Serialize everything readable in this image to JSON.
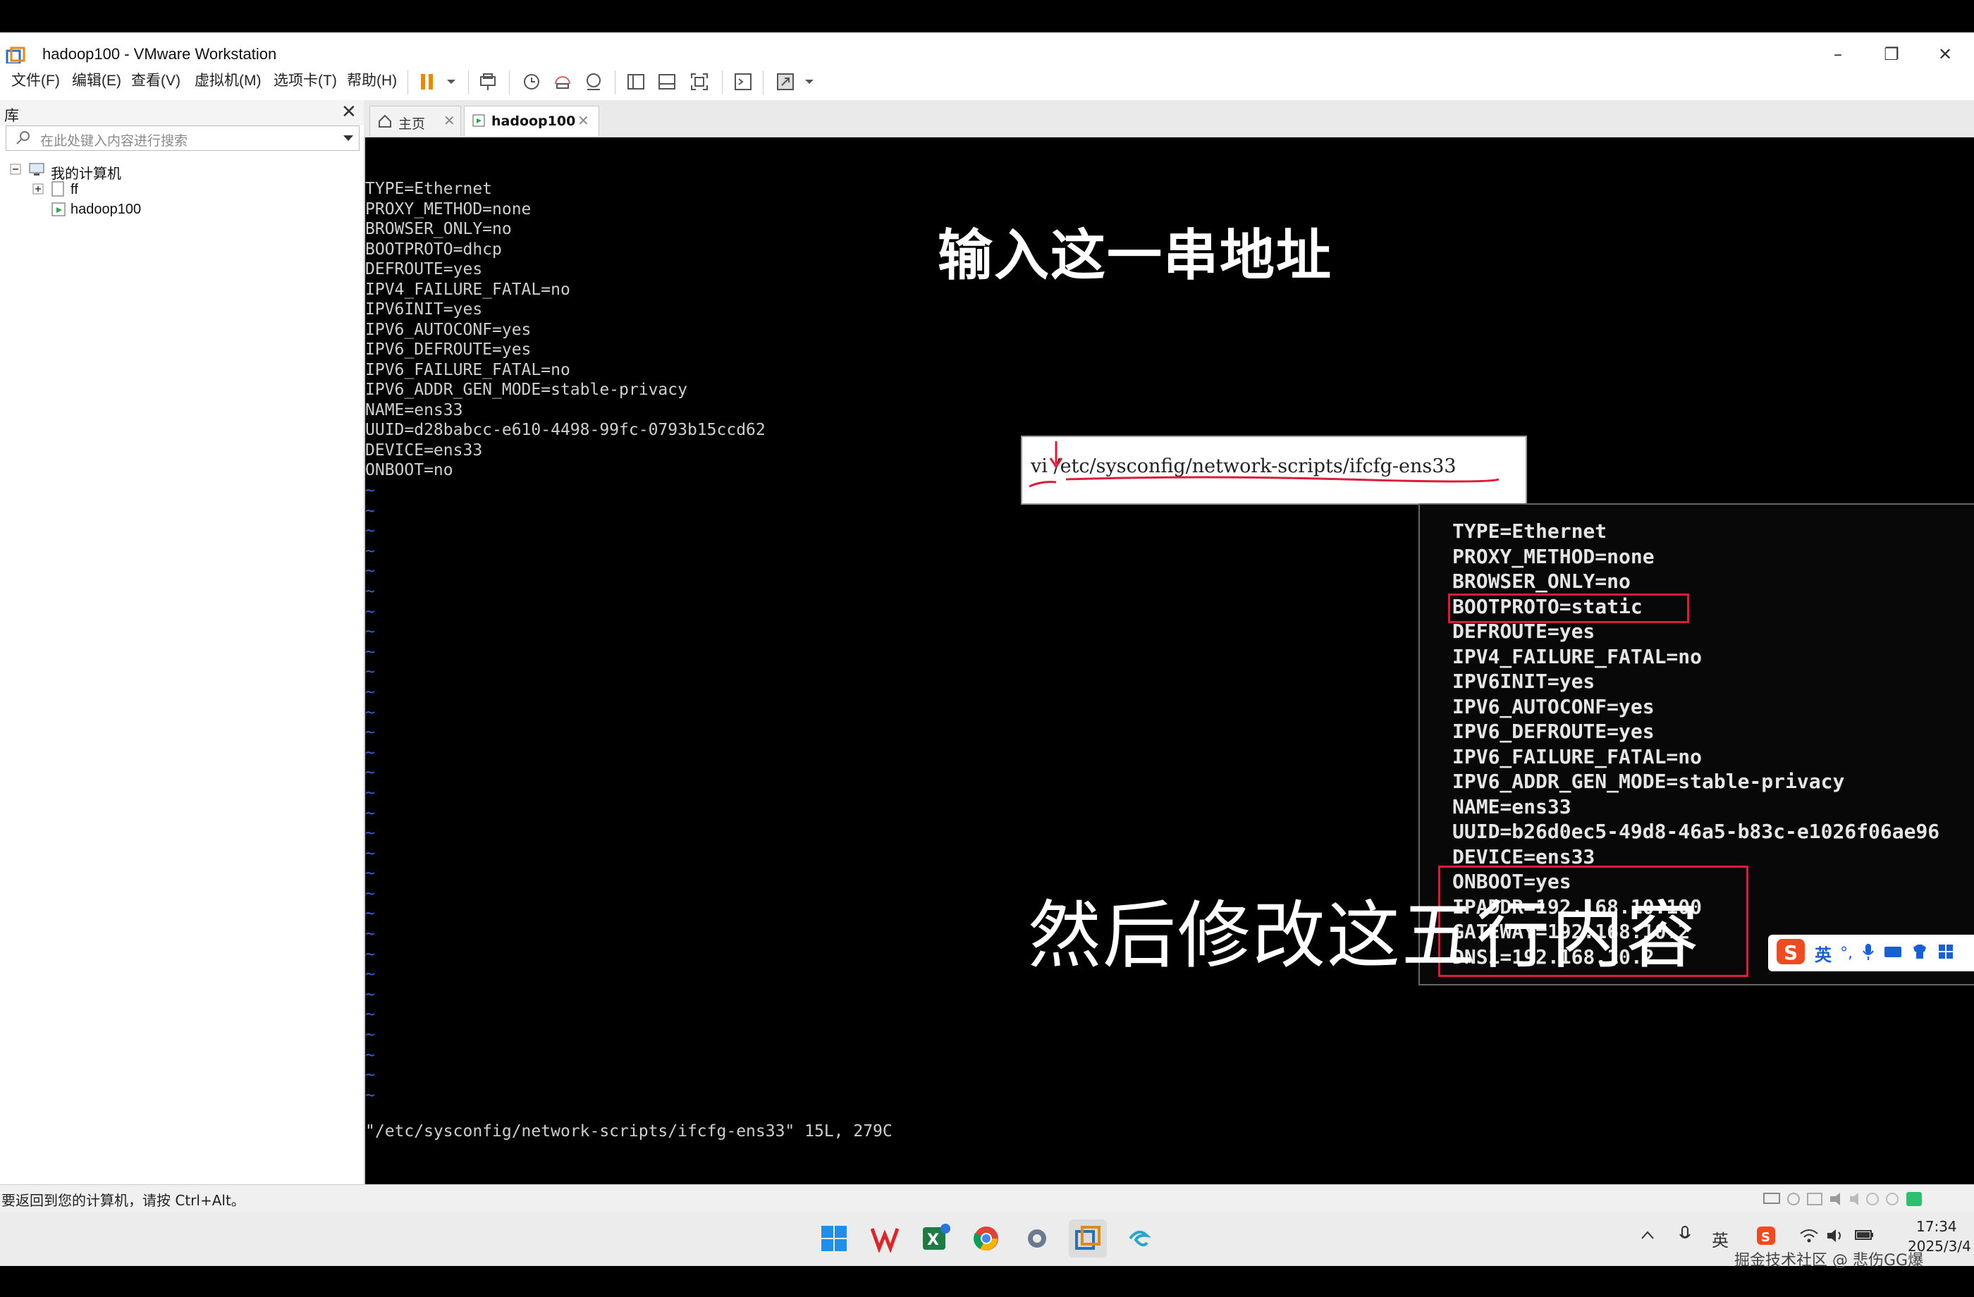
{
  "window": {
    "title": "hadoop100 - VMware Workstation",
    "minimize": "–",
    "restore": "❐",
    "close": "✕"
  },
  "menu": [
    "文件(F)",
    "编辑(E)",
    "查看(V)",
    "虚拟机(M)",
    "选项卡(T)",
    "帮助(H)"
  ],
  "library": {
    "title": "库",
    "close": "✕",
    "search_placeholder": "在此处键入内容进行搜索",
    "root": "我的计算机",
    "items": [
      "ff",
      "hadoop100"
    ]
  },
  "tabs": [
    {
      "label": "主页"
    },
    {
      "label": "hadoop100"
    }
  ],
  "terminal": {
    "lines": [
      "TYPE=Ethernet",
      "PROXY_METHOD=none",
      "BROWSER_ONLY=no",
      "BOOTPROTO=dhcp",
      "DEFROUTE=yes",
      "IPV4_FAILURE_FATAL=no",
      "IPV6INIT=yes",
      "IPV6_AUTOCONF=yes",
      "IPV6_DEFROUTE=yes",
      "IPV6_FAILURE_FATAL=no",
      "IPV6_ADDR_GEN_MODE=stable-privacy",
      "NAME=ens33",
      "UUID=d28babcc-e610-4498-99fc-0793b15ccd62",
      "DEVICE=ens33",
      "ONBOOT=no"
    ],
    "status": "\"/etc/sysconfig/network-scripts/ifcfg-ens33\" 15L, 279C"
  },
  "overlay": {
    "caption_top": "输入这一串地址",
    "command": "vi /etc/sysconfig/network-scripts/ifcfg-ens33",
    "caption_bottom": "然后修改这五行内容",
    "zoom_lines": [
      "TYPE=Ethernet",
      "PROXY_METHOD=none",
      "BROWSER_ONLY=no",
      "BOOTPROTO=static",
      "DEFROUTE=yes",
      "IPV4_FAILURE_FATAL=no",
      "IPV6INIT=yes",
      "IPV6_AUTOCONF=yes",
      "IPV6_DEFROUTE=yes",
      "IPV6_FAILURE_FATAL=no",
      "IPV6_ADDR_GEN_MODE=stable-privacy",
      "NAME=ens33",
      "UUID=b26d0ec5-49d8-46a5-b83c-e1026f06ae96",
      "DEVICE=ens33",
      "ONBOOT=yes",
      "IPADDR=192.168.10.100",
      "GATEWAY=192.168.10.2",
      "DNS1=192.168.10.2"
    ]
  },
  "ime": {
    "mode": "英"
  },
  "statusbar": {
    "hint": "要返回到您的计算机，请按 Ctrl+Alt。"
  },
  "taskbar": {
    "time": "17:34",
    "date": "2025/3/4",
    "tray_lang": "英",
    "watermark": "掘金技术社区 @ 悲伤GG爆"
  },
  "colors": {
    "accent_red": "#d91d3a",
    "tilde_blue": "#3d5fd4"
  }
}
